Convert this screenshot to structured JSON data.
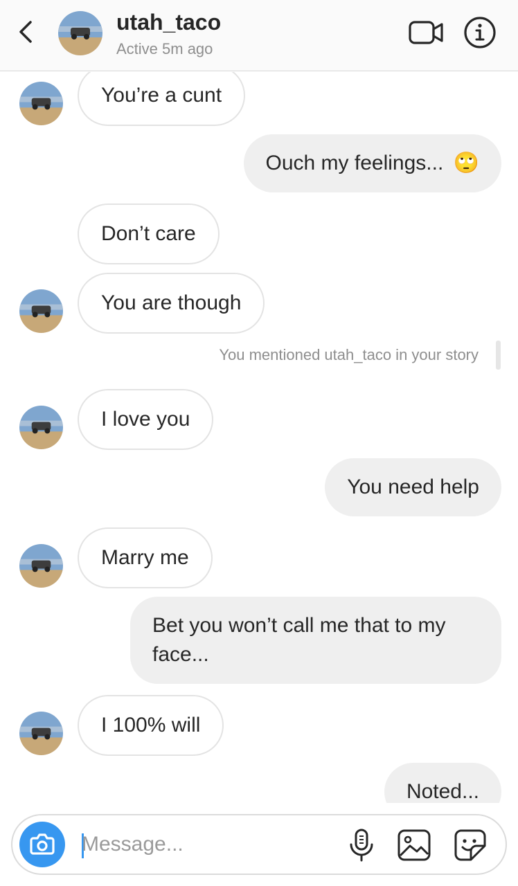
{
  "header": {
    "username": "utah_taco",
    "status": "Active 5m ago"
  },
  "messages": [
    {
      "side": "in",
      "text": "You’re a cunt"
    },
    {
      "side": "out",
      "text": "Ouch my feelings...",
      "emoji": "🙄"
    },
    {
      "side": "in",
      "text": "Don’t care"
    },
    {
      "side": "in",
      "text": "You are though"
    },
    {
      "side": "out",
      "text": "You need help"
    },
    {
      "side": "in",
      "text": "I love you"
    },
    {
      "side": "in",
      "text": "Marry me"
    },
    {
      "side": "out",
      "text_line1": "Bet you won’t call me that to my",
      "text_line2": "face..."
    },
    {
      "side": "in",
      "text": "I 100% will"
    },
    {
      "side": "out",
      "text": "Noted..."
    }
  ],
  "notice": "You mentioned utah_taco in your story",
  "composer": {
    "placeholder": "Message..."
  },
  "icons": [
    "back-chevron-icon",
    "video-call-icon",
    "info-icon",
    "camera-icon",
    "microphone-icon",
    "gallery-icon",
    "sticker-icon"
  ],
  "colors": {
    "accent": "#3797f0",
    "outgoing_bubble": "#efefef",
    "incoming_border": "#e3e3e3",
    "secondary_text": "#8e8e8e"
  }
}
